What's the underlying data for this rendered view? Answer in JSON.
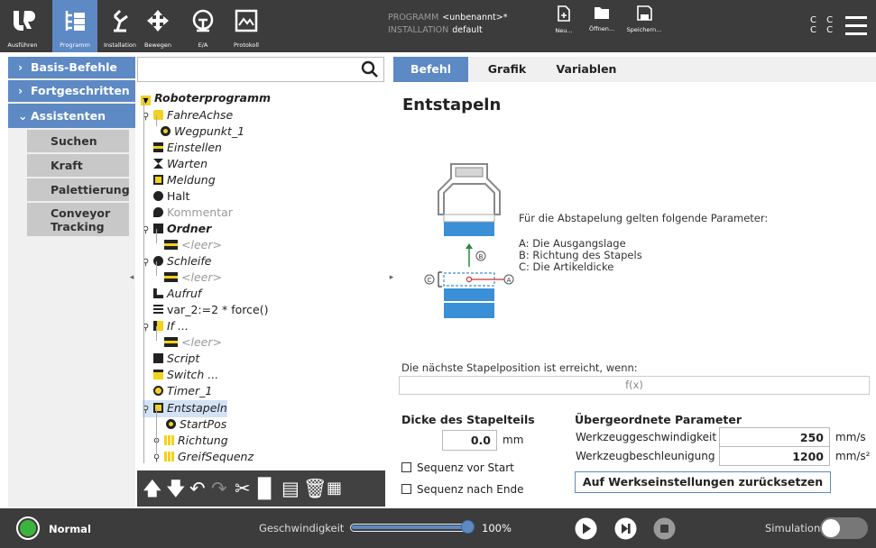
{
  "header": {
    "nav": [
      {
        "id": "run",
        "label": "Ausführen",
        "icon": "ur-logo-icon"
      },
      {
        "id": "program",
        "label": "Programm",
        "icon": "program-icon",
        "selected": true
      },
      {
        "id": "installation",
        "label": "Installation",
        "icon": "installation-icon"
      },
      {
        "id": "move",
        "label": "Bewegen",
        "icon": "move-icon"
      },
      {
        "id": "io",
        "label": "E/A",
        "icon": "io-icon"
      },
      {
        "id": "log",
        "label": "Protokoll",
        "icon": "log-icon"
      }
    ],
    "program_key": "PROGRAMM",
    "program_val": "<unbenannt>*",
    "installation_key": "INSTALLATION",
    "installation_val": "default",
    "file_buttons": [
      {
        "label": "Neu..."
      },
      {
        "label": "Öffnen..."
      },
      {
        "label": "Speichern..."
      }
    ],
    "cc": "C C\nC C",
    "accent": "#5d89c4"
  },
  "left_panel": {
    "categories": [
      {
        "label": "Basis-Befehle"
      },
      {
        "label": "Fortgeschritten"
      },
      {
        "label": "Assistenten"
      }
    ],
    "subitems": [
      {
        "label": "Suchen"
      },
      {
        "label": "Kraft"
      },
      {
        "label": "Palettierung"
      },
      {
        "label": "Conveyor Tracking"
      }
    ]
  },
  "tree": {
    "search_placeholder": "",
    "root": "Roboterprogramm",
    "nodes": [
      {
        "label": "FahreAchse"
      },
      {
        "label": "Wegpunkt_1"
      },
      {
        "label": "Einstellen"
      },
      {
        "label": "Warten"
      },
      {
        "label": "Meldung"
      },
      {
        "label": "Halt"
      },
      {
        "label": "Kommentar"
      },
      {
        "label": "Ordner"
      },
      {
        "label": "<leer>"
      },
      {
        "label": "Schleife"
      },
      {
        "label": "<leer>"
      },
      {
        "label": "Aufruf"
      },
      {
        "label": "var_2:=2 * force()"
      },
      {
        "label": "If ..."
      },
      {
        "label": "<leer>"
      },
      {
        "label": "Script"
      },
      {
        "label": "Switch ..."
      },
      {
        "label": "Timer_1"
      },
      {
        "label": "Entstapeln"
      },
      {
        "label": "StartPos"
      },
      {
        "label": "Richtung"
      },
      {
        "label": "GreifSequenz"
      }
    ]
  },
  "tabs": [
    {
      "label": "Befehl"
    },
    {
      "label": "Grafik"
    },
    {
      "label": "Variablen"
    }
  ],
  "main": {
    "title": "Entstapeln",
    "intro": "Für die Abstapelung gelten folgende Parameter:",
    "param_a": "A: Die Ausgangslage",
    "param_b": "B: Richtung des Stapels",
    "param_c": "C: Die Artikeldicke",
    "diag_a": "A",
    "diag_b": "B",
    "diag_c": "C",
    "condition_label": "Die nächste Stapelposition ist erreicht, wenn:",
    "condition_value": "f(x)",
    "thickness_label": "Dicke des Stapelteils",
    "thickness_value": "0.0",
    "thickness_unit": "mm",
    "seq_before": "Sequenz vor Start",
    "seq_after": "Sequenz nach Ende",
    "parent_label": "Übergeordnete Parameter",
    "tool_speed_label": "Werkzeuggeschwindigkeit",
    "tool_speed_value": "250",
    "tool_speed_unit": "mm/s",
    "tool_acc_label": "Werkzeugbeschleunigung",
    "tool_acc_value": "1200",
    "tool_acc_unit": "mm/s²",
    "reset_label": "Auf Werkseinstellungen zurücksetzen"
  },
  "footer": {
    "status": "Normal",
    "status_color": "#3cb33c",
    "speed_label": "Geschwindigkeit",
    "speed_value": "100%",
    "speed_fraction": 1.0,
    "simulation_label": "Simulation"
  }
}
